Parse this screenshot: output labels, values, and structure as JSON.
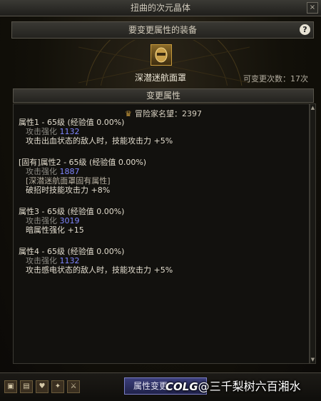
{
  "window": {
    "title": "扭曲的次元晶体",
    "close_glyph": "×"
  },
  "equip": {
    "header": "要变更属性的装备",
    "help_glyph": "?",
    "item_name": "深潜迷航面罩",
    "change_count": "可变更次数：17次"
  },
  "section": {
    "title": "变更属性"
  },
  "reputation": {
    "icon": "reputation-icon",
    "text": "冒险家名望：2397"
  },
  "attributes": [
    {
      "title": "属性1 - 65级 (经验值 0.00%)",
      "sub_label": "攻击强化",
      "sub_value": "1132",
      "effect": "攻击出血状态的敌人时，技能攻击力 +5%"
    },
    {
      "title": "[固有]属性2 - 65级 (经验值 0.00%)",
      "sub_label": "攻击强化",
      "sub_value": "1887",
      "note": "[深潜迷航面罩固有属性]",
      "effect": "破招时技能攻击力 +8%"
    },
    {
      "title": "属性3 - 65级 (经验值 0.00%)",
      "sub_label": "攻击强化",
      "sub_value": "3019",
      "effect": "暗属性强化 +15"
    },
    {
      "title": "属性4 - 65级 (经验值 0.00%)",
      "sub_label": "攻击强化",
      "sub_value": "1132",
      "effect": "攻击感电状态的敌人时，技能攻击力 +5%"
    }
  ],
  "bottom": {
    "button": "属性变更",
    "watermark_logo": "COLG",
    "watermark_text": "@三千梨树六百湘水"
  },
  "colors": {
    "accent_blue": "#7f86ff",
    "gold": "#c89b3c"
  }
}
